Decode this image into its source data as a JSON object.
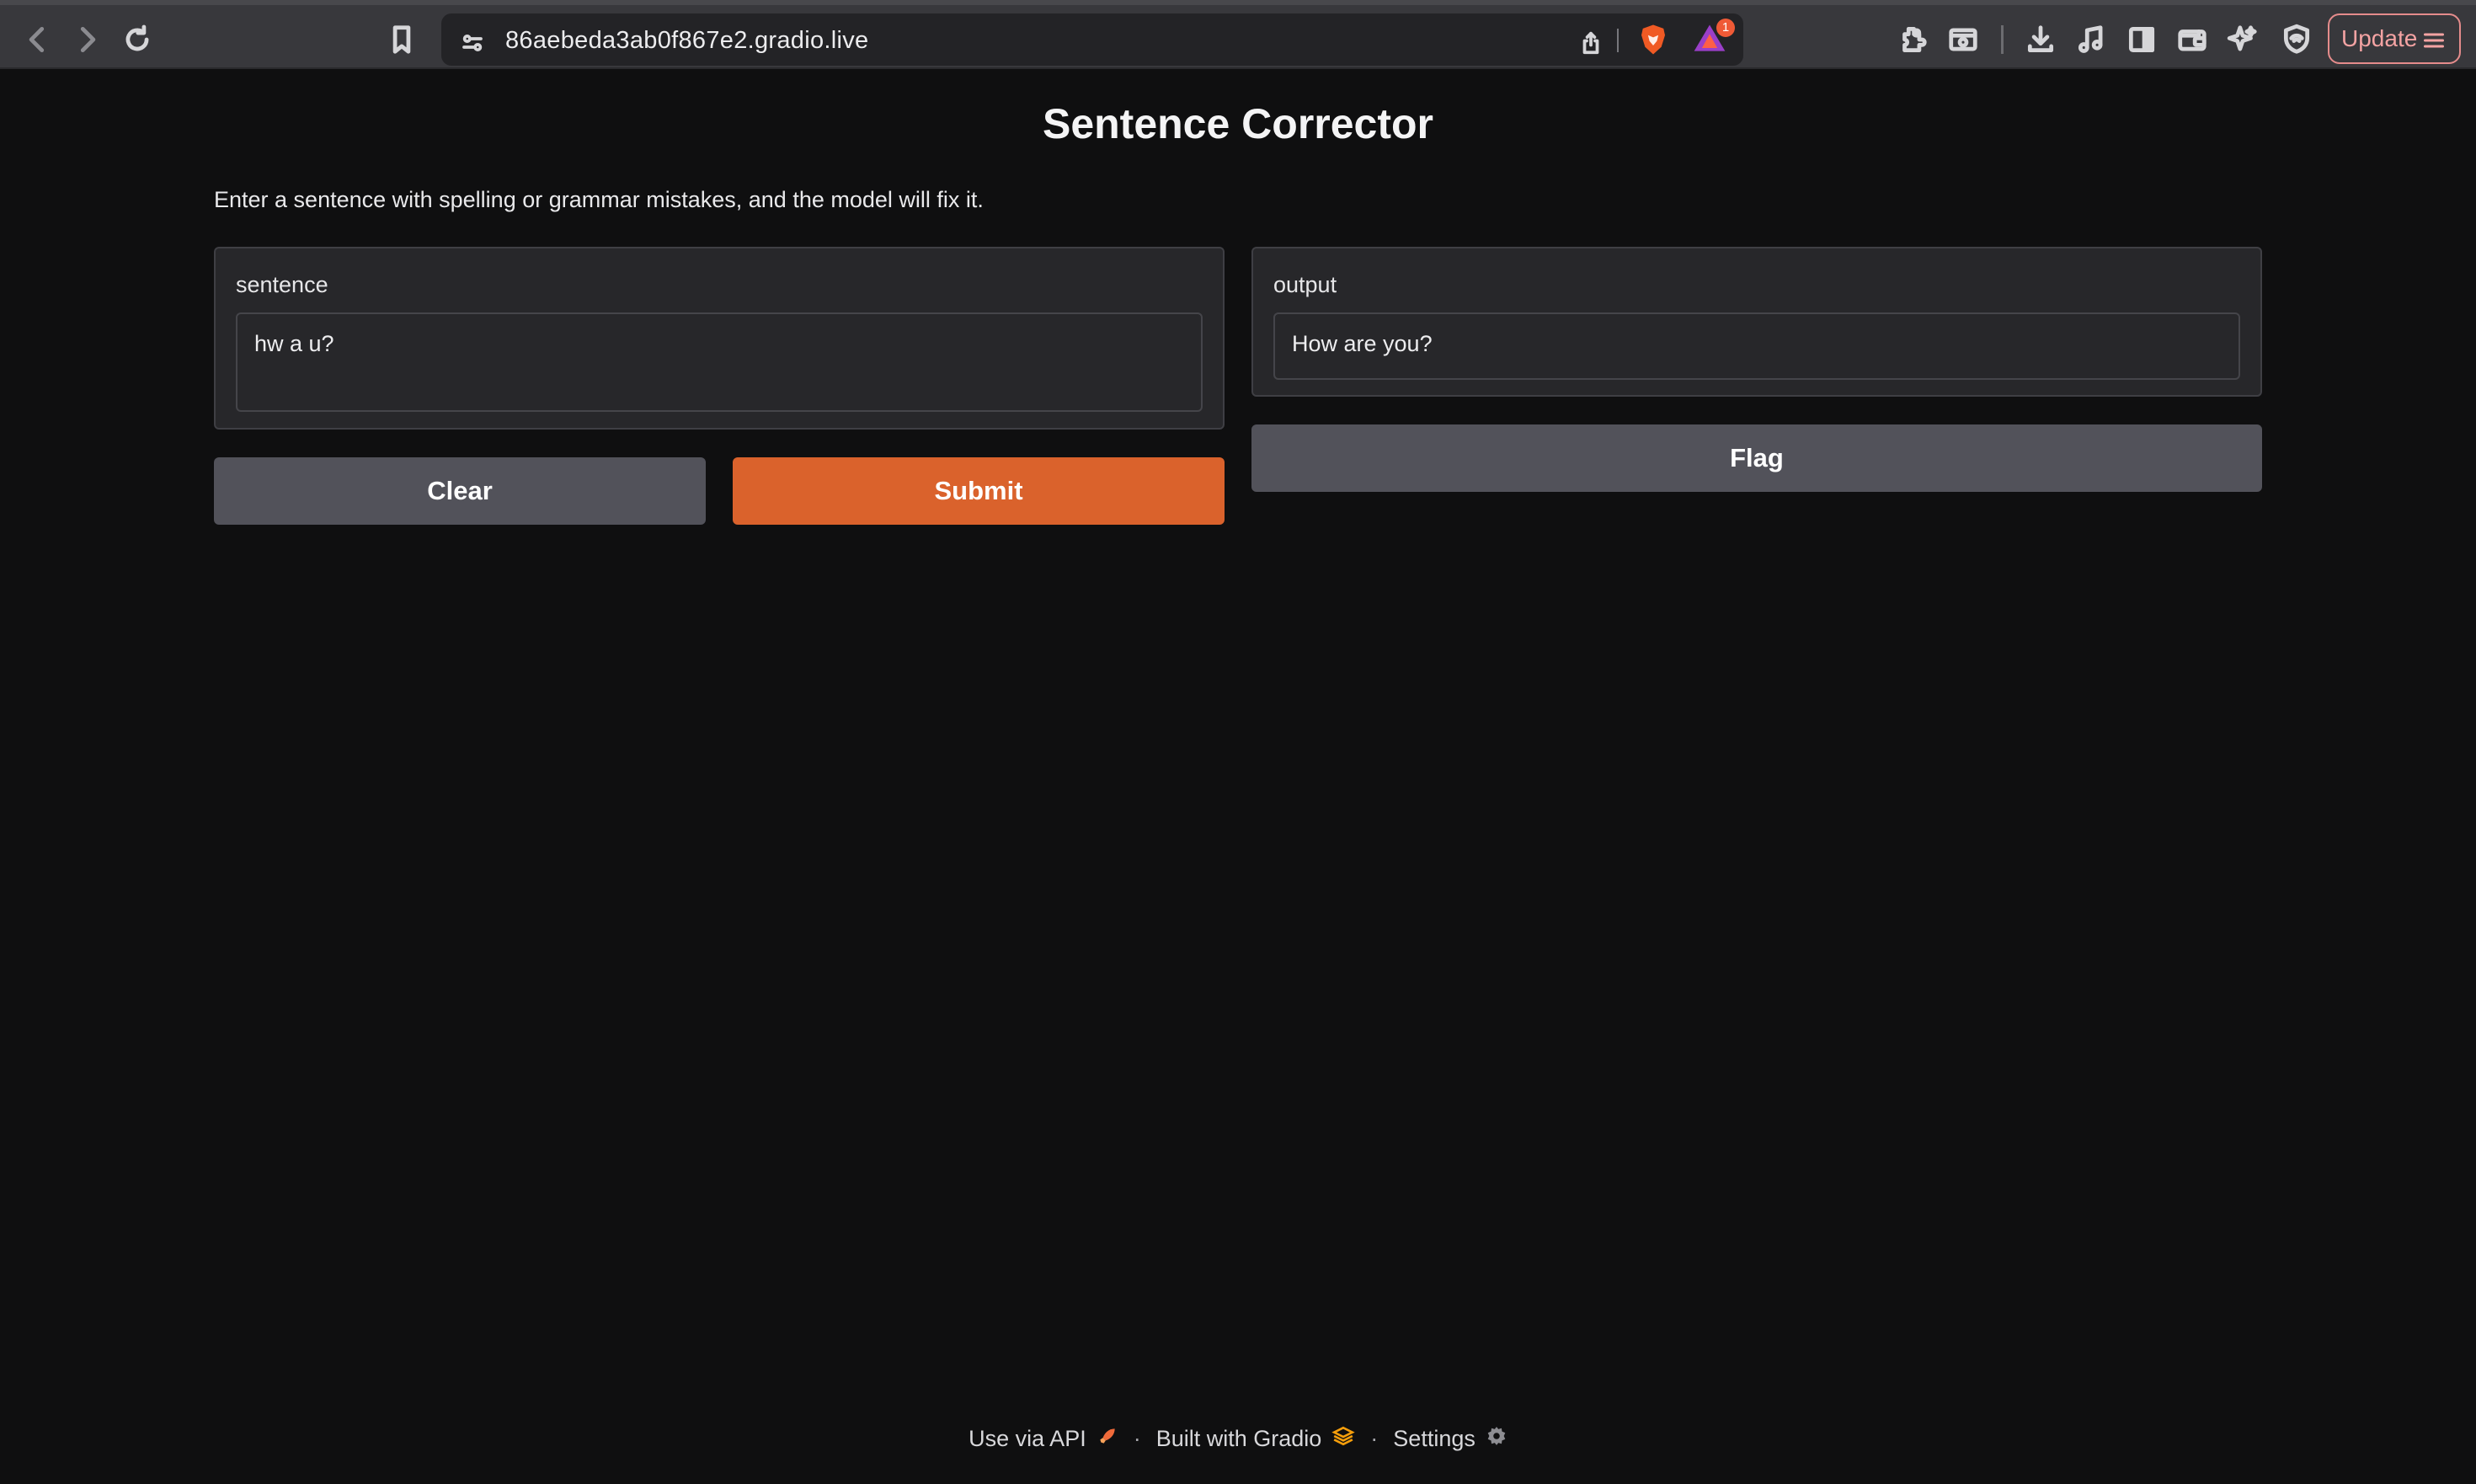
{
  "browser": {
    "url": "86aebeda3ab0f867e2.gradio.live",
    "update_label": "Update",
    "rewards_badge": "1",
    "colors": {
      "chrome": "#38383c",
      "urlbar": "#232326",
      "update_border": "#e58c8c"
    }
  },
  "app": {
    "title": "Sentence Corrector",
    "description": "Enter a sentence with spelling or grammar mistakes, and the model will fix it.",
    "input": {
      "label": "sentence",
      "value": "hw a u?"
    },
    "output": {
      "label": "output",
      "value": "How are you?"
    },
    "buttons": {
      "clear": "Clear",
      "submit": "Submit",
      "flag": "Flag"
    },
    "colors": {
      "primary": "#da622c",
      "secondary": "#52525a",
      "background": "#0f0f10",
      "panel": "#27272a"
    }
  },
  "footer": {
    "api_label": "Use via API",
    "built_label": "Built with Gradio",
    "settings_label": "Settings",
    "separator": "·"
  },
  "icons": [
    "back-icon",
    "forward-icon",
    "reload-icon",
    "bookmark-icon",
    "site-settings-icon",
    "share-icon",
    "brave-shield-icon",
    "brave-rewards-icon",
    "extensions-icon",
    "screenshot-icon",
    "downloads-icon",
    "media-icon",
    "sidebar-icon",
    "wallet-icon",
    "leo-ai-icon",
    "vpn-icon",
    "menu-icon",
    "rocket-icon",
    "gradio-logo-icon",
    "gear-icon"
  ]
}
